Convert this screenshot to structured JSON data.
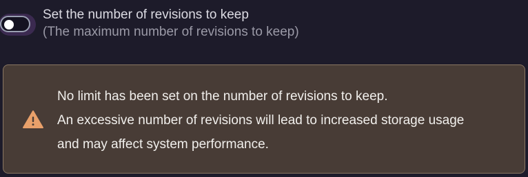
{
  "setting": {
    "label": "Set the number of revisions to keep",
    "description": "(The maximum number of revisions to keep)",
    "toggle_state": "off"
  },
  "warning": {
    "icon": "warning-triangle-icon",
    "lines": [
      "No limit has been set on the number of revisions to keep.",
      "An excessive number of revisions will lead to increased storage usage",
      "and may affect system performance."
    ]
  },
  "colors": {
    "background": "#1d1b2a",
    "toggle_ring": "#3b2a50",
    "warning_background": "#483c36",
    "warning_border": "#8a7762",
    "warning_icon": "#e8a06a"
  }
}
